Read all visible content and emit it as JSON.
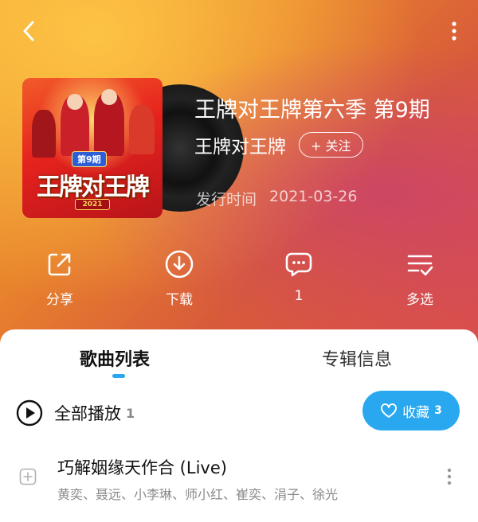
{
  "header": {
    "back_icon": "chevron-left-icon",
    "more_icon": "vertical-dots-icon"
  },
  "album": {
    "title": "王牌对王牌第六季 第9期",
    "artist": "王牌对王牌",
    "follow_label": "+ 关注",
    "release_label": "发行时间",
    "release_date": "2021-03-26",
    "cover": {
      "badge": "第9期",
      "logo": "王牌对王牌",
      "year": "2021"
    }
  },
  "actions": [
    {
      "label": "分享",
      "icon": "share-icon"
    },
    {
      "label": "下载",
      "icon": "download-icon"
    },
    {
      "label": "1",
      "icon": "comment-icon"
    },
    {
      "label": "多选",
      "icon": "multi-select-icon"
    }
  ],
  "tabs": {
    "songs": "歌曲列表",
    "info": "专辑信息"
  },
  "play_all": {
    "label": "全部播放",
    "count": "1"
  },
  "collect": {
    "label": "收藏",
    "count": "3"
  },
  "songs": [
    {
      "title": "巧解姻缘天作合 (Live)",
      "artists": "黄奕、聂远、小李琳、师小红、崔奕、涓子、徐光"
    }
  ],
  "colors": {
    "accent": "#29a8f0",
    "hero_start": "#f0a534",
    "hero_end": "#d94e4e"
  }
}
